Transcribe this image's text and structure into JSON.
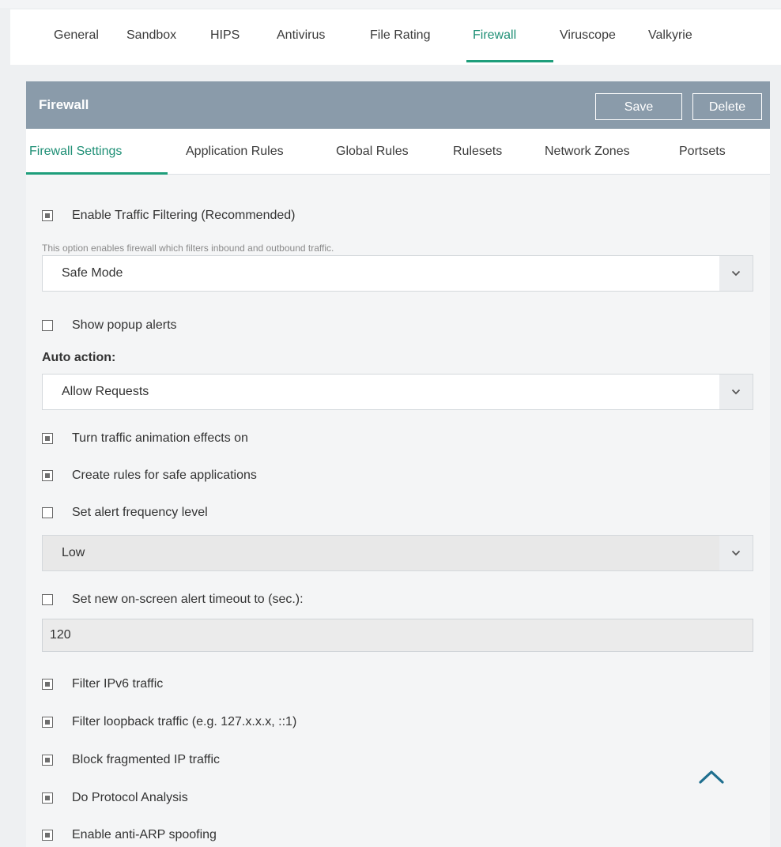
{
  "outer_tabs": [
    {
      "label": "General"
    },
    {
      "label": "Sandbox"
    },
    {
      "label": "HIPS"
    },
    {
      "label": "Antivirus"
    },
    {
      "label": "File Rating"
    },
    {
      "label": "Firewall",
      "active": true
    },
    {
      "label": "Viruscope"
    },
    {
      "label": "Valkyrie"
    }
  ],
  "panel": {
    "title": "Firewall",
    "save_label": "Save",
    "delete_label": "Delete"
  },
  "inner_tabs": [
    {
      "label": "Firewall Settings",
      "active": true
    },
    {
      "label": "Application Rules"
    },
    {
      "label": "Global Rules"
    },
    {
      "label": "Rulesets"
    },
    {
      "label": "Network Zones"
    },
    {
      "label": "Portsets"
    }
  ],
  "settings": {
    "enable_traffic_filtering": {
      "label": "Enable Traffic Filtering (Recommended)",
      "checked": true
    },
    "filtering_hint": "This option enables firewall which filters inbound and outbound traffic.",
    "mode_select": {
      "value": "Safe Mode"
    },
    "show_popup_alerts": {
      "label": "Show popup alerts",
      "checked": false
    },
    "auto_action_label": "Auto action:",
    "auto_action_select": {
      "value": "Allow Requests"
    },
    "traffic_animation": {
      "label": "Turn traffic animation effects on",
      "checked": true
    },
    "create_rules_safe": {
      "label": "Create rules for safe applications",
      "checked": true
    },
    "alert_frequency": {
      "label": "Set alert frequency level",
      "checked": false
    },
    "alert_frequency_select": {
      "value": "Low"
    },
    "alert_timeout": {
      "label": "Set new on-screen alert timeout to (sec.):",
      "checked": false
    },
    "alert_timeout_value": "120",
    "filter_ipv6": {
      "label": "Filter IPv6 traffic",
      "checked": true
    },
    "filter_loopback": {
      "label": "Filter loopback traffic (e.g. 127.x.x.x, ::1)",
      "checked": true
    },
    "block_fragmented": {
      "label": "Block fragmented IP traffic",
      "checked": true
    },
    "protocol_analysis": {
      "label": "Do Protocol Analysis",
      "checked": true
    },
    "anti_arp": {
      "label": "Enable anti-ARP spoofing",
      "checked": true
    }
  },
  "colors": {
    "accent": "#1e9e7b",
    "header_bg": "#8a9baa"
  },
  "icons": {
    "select_arrow": "chevron-down-icon",
    "scroll_top": "chevron-up-icon"
  }
}
